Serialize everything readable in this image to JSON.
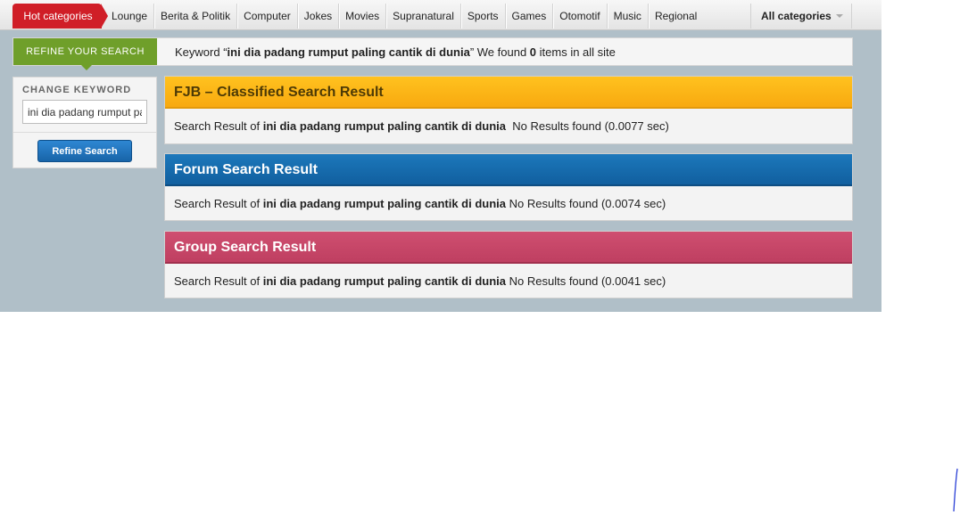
{
  "nav": {
    "hot_label": "Hot categories",
    "items": [
      "Lounge",
      "Berita & Politik",
      "Computer",
      "Jokes",
      "Movies",
      "Supranatural",
      "Sports",
      "Games",
      "Otomotif",
      "Music",
      "Regional"
    ],
    "all_categories": "All categories"
  },
  "search_summary": {
    "refine_label": "REFINE YOUR SEARCH",
    "prefix": "Keyword “",
    "keyword": "ini dia padang rumput paling cantik di dunia",
    "mid": "” We found ",
    "count": "0",
    "suffix": " items in all site"
  },
  "sidebar": {
    "change_keyword_label": "CHANGE KEYWORD",
    "keyword_value": "ini dia padang rumput paling cantik di dunia",
    "refine_button": "Refine Search"
  },
  "panels": {
    "fjb": {
      "title": "FJB – Classified Search Result",
      "prefix": "Search Result of ",
      "keyword": "ini dia padang rumput paling cantik di dunia",
      "status": "  No Results found (0.0077 sec)"
    },
    "forum": {
      "title": "Forum Search Result",
      "prefix": "Search Result of ",
      "keyword": "ini dia padang rumput paling cantik di dunia",
      "status": " No Results found (0.0074 sec)"
    },
    "group": {
      "title": "Group Search Result",
      "prefix": "Search Result of ",
      "keyword": "ini dia padang rumput paling cantik di dunia",
      "status": " No Results found (0.0041 sec)"
    }
  },
  "colors": {
    "hot": "#d01e27",
    "refine_green": "#6f9f2a",
    "fjb_header": "#ffc21f",
    "forum_header": "#1c78bb",
    "group_header": "#cf4f70",
    "background": "#b0bfc8"
  }
}
